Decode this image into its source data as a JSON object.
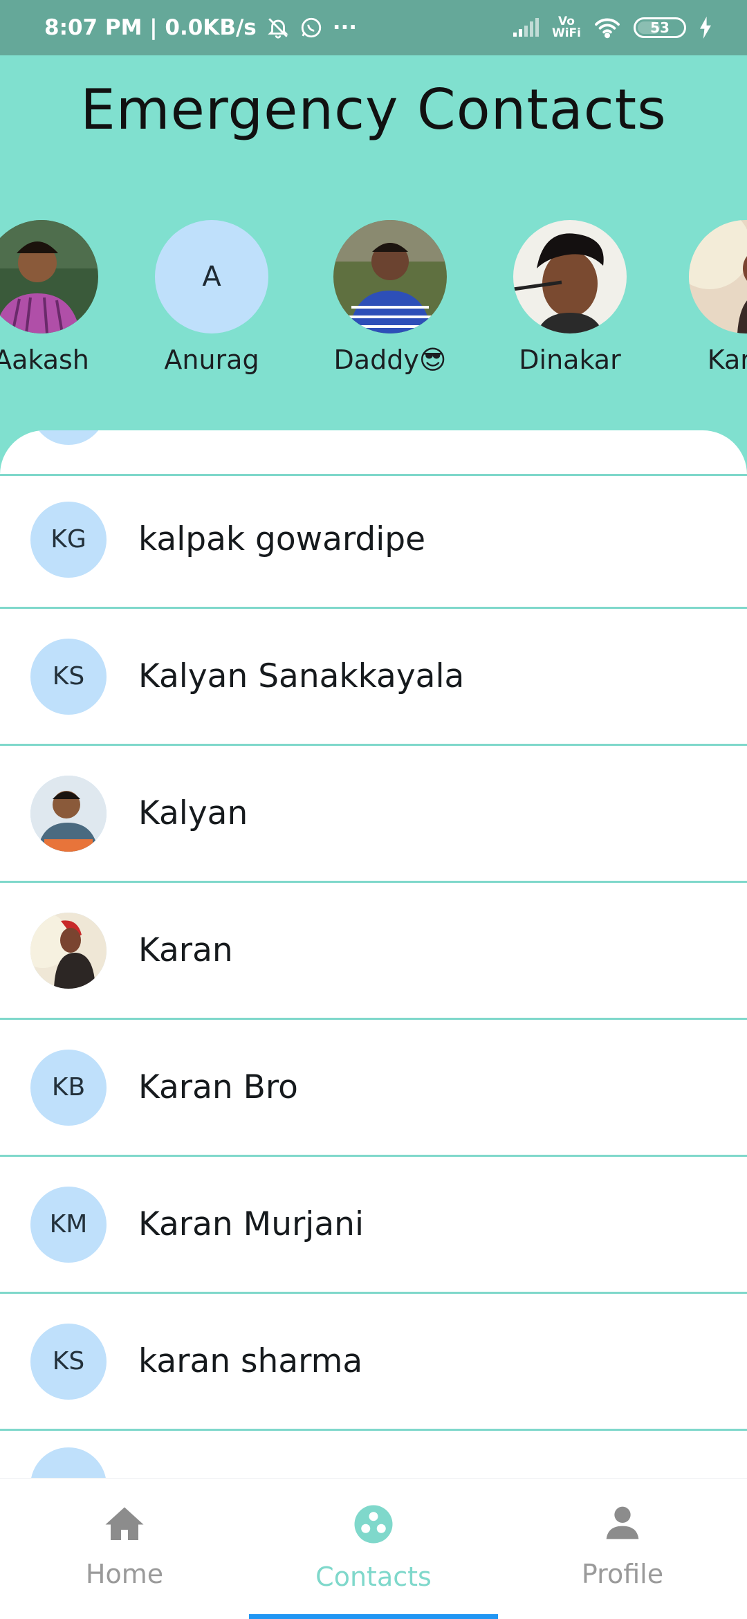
{
  "status_bar": {
    "time_speed": "8:07 PM | 0.0KB/s",
    "more": "···",
    "volte_top": "Vo",
    "volte_bottom": "WiFi",
    "battery": "53"
  },
  "header": {
    "title": "Emergency Contacts"
  },
  "favorites": [
    {
      "name": "Aakash",
      "type": "photo",
      "initials": ""
    },
    {
      "name": "Anurag",
      "type": "initial",
      "initials": "A"
    },
    {
      "name": "Daddy😎",
      "type": "photo",
      "initials": ""
    },
    {
      "name": "Dinakar",
      "type": "photo",
      "initials": ""
    },
    {
      "name": "Karan",
      "type": "photo",
      "initials": ""
    }
  ],
  "contacts": [
    {
      "name": "kalpak gowardipe",
      "initials": "KG",
      "type": "initial"
    },
    {
      "name": "Kalyan Sanakkayala",
      "initials": "KS",
      "type": "initial"
    },
    {
      "name": "Kalyan",
      "initials": "",
      "type": "photo"
    },
    {
      "name": "Karan",
      "initials": "",
      "type": "photo"
    },
    {
      "name": "Karan Bro",
      "initials": "KB",
      "type": "initial"
    },
    {
      "name": "Karan Murjani",
      "initials": "KM",
      "type": "initial"
    },
    {
      "name": "karan sharma",
      "initials": "KS",
      "type": "initial"
    }
  ],
  "bottom_nav": {
    "home": "Home",
    "contacts": "Contacts",
    "profile": "Profile",
    "active": "contacts"
  },
  "colors": {
    "accent": "#80e0cf",
    "status_bar": "#65a899",
    "avatar_bg": "#bfe0fb",
    "divider": "#7fd8cb",
    "nav_indicator": "#2196f3"
  }
}
